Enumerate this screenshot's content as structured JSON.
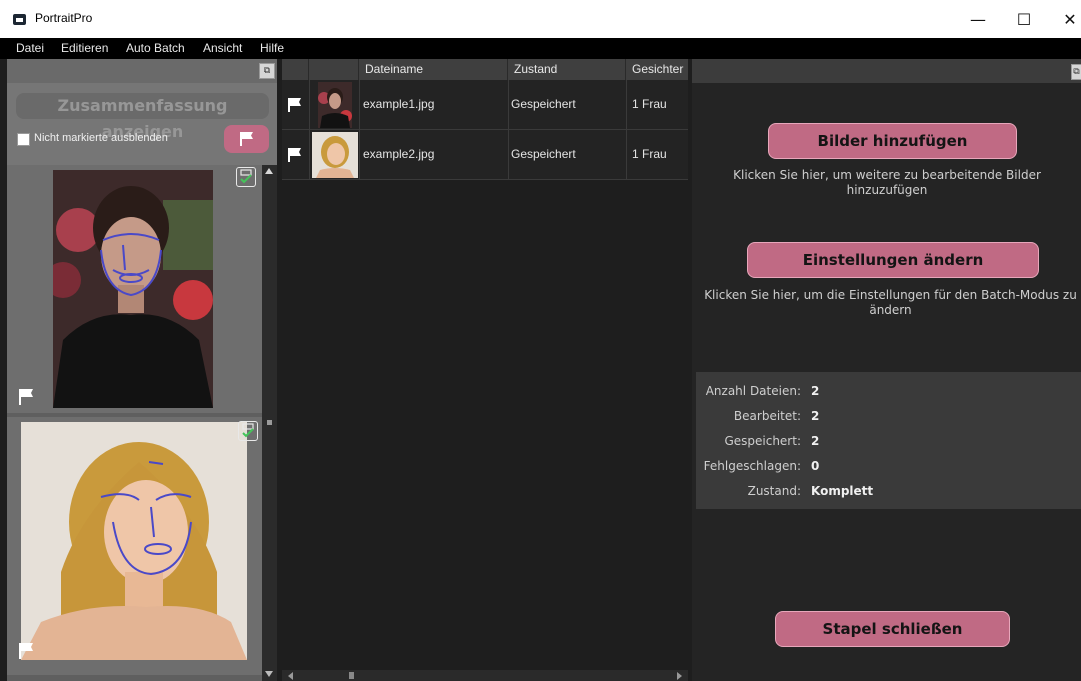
{
  "window": {
    "title": "PortraitPro",
    "minimize_glyph": "—",
    "maximize_glyph": "☐",
    "close_glyph": "✕"
  },
  "menu": [
    {
      "label": "Datei"
    },
    {
      "label": "Editieren"
    },
    {
      "label": "Auto Batch"
    },
    {
      "label": "Ansicht"
    },
    {
      "label": "Hilfe"
    }
  ],
  "left": {
    "summary_button": "Zusammenfassung anzeigen",
    "hide_unmarked_label": "Nicht markierte ausblenden",
    "hide_unmarked_checked": false
  },
  "table": {
    "columns": [
      "Dateiname",
      "Zustand",
      "Gesichter"
    ],
    "rows": [
      {
        "file": "example1.jpg",
        "status": "Gespeichert",
        "faces": "1 Frau"
      },
      {
        "file": "example2.jpg",
        "status": "Gespeichert",
        "faces": "1 Frau"
      }
    ]
  },
  "right": {
    "add_images_button": "Bilder hinzufügen",
    "add_images_hint": "Klicken Sie hier, um weitere zu bearbeitende Bilder hinzuzufügen",
    "settings_button": "Einstellungen ändern",
    "settings_hint": "Klicken Sie hier, um die Einstellungen für den Batch-Modus zu ändern",
    "stats": [
      {
        "label": "Anzahl Dateien:",
        "value": "2"
      },
      {
        "label": "Bearbeitet:",
        "value": "2"
      },
      {
        "label": "Gespeichert:",
        "value": "2"
      },
      {
        "label": "Fehlgeschlagen:",
        "value": "0"
      },
      {
        "label": "Zustand:",
        "value": "Komplett"
      }
    ],
    "close_batch_button": "Stapel schließen"
  },
  "colors": {
    "accent_pink": "#c06a84",
    "menubar": "#000000",
    "panel_dark": "#242424"
  }
}
